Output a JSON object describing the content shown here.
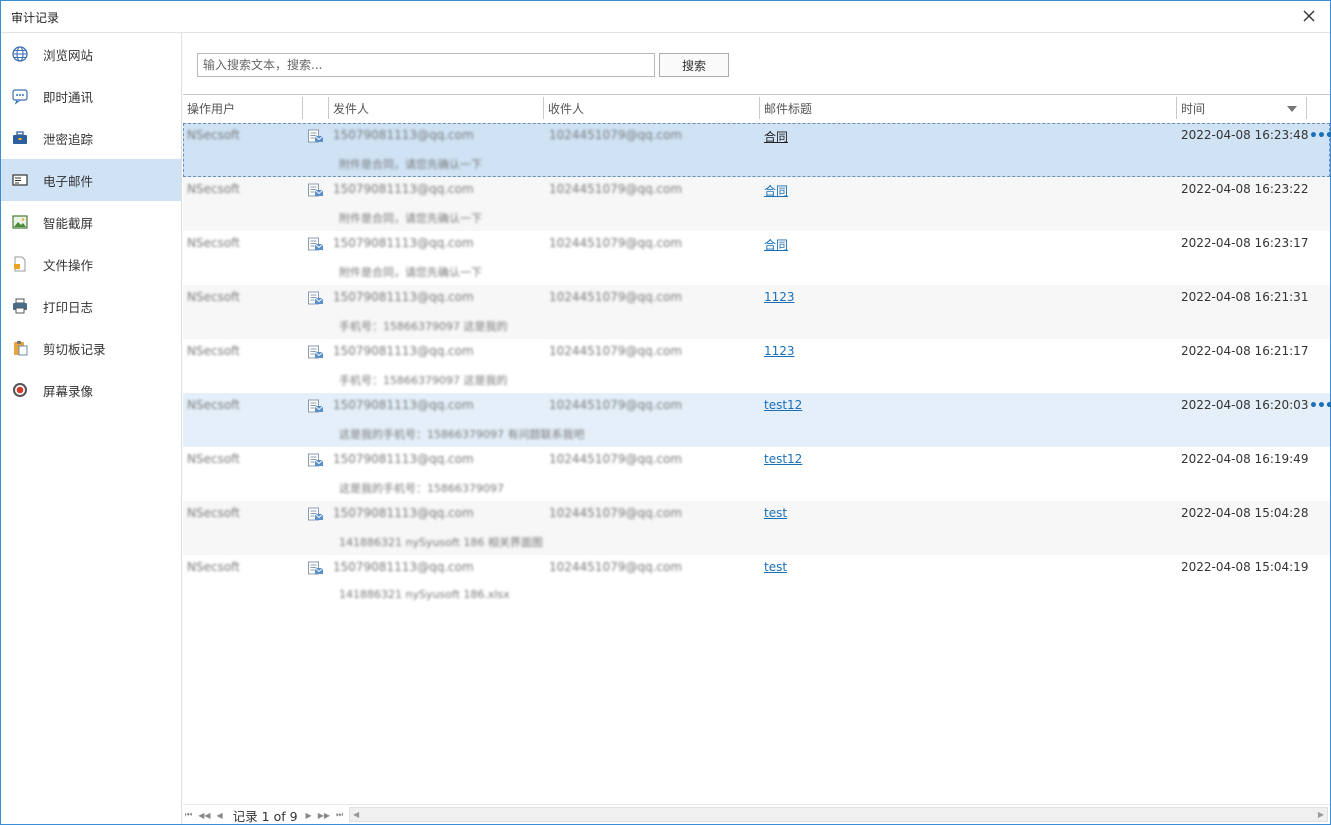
{
  "window": {
    "title": "审计记录"
  },
  "sidebar": {
    "items": [
      {
        "label": "浏览网站",
        "icon": "globe-icon"
      },
      {
        "label": "即时通讯",
        "icon": "chat-bubble-icon"
      },
      {
        "label": "泄密追踪",
        "icon": "briefcase-icon"
      },
      {
        "label": "电子邮件",
        "icon": "email-icon"
      },
      {
        "label": "智能截屏",
        "icon": "image-icon"
      },
      {
        "label": "文件操作",
        "icon": "file-icon"
      },
      {
        "label": "打印日志",
        "icon": "printer-icon"
      },
      {
        "label": "剪切板记录",
        "icon": "clipboard-icon"
      },
      {
        "label": "屏幕录像",
        "icon": "record-icon"
      }
    ],
    "active_index": 3
  },
  "search": {
    "placeholder": "输入搜索文本，搜索...",
    "button_label": "搜索"
  },
  "grid": {
    "columns": [
      "操作用户",
      "发件人",
      "收件人",
      "邮件标题",
      "时间"
    ],
    "rows": [
      {
        "user": "NSecsoft",
        "from": "15079081113@qq.com",
        "to": "1024451079@qq.com",
        "subject": "合同",
        "time": "2022-04-08 16:23:48",
        "snippet": "附件是合同，请您先确认一下"
      },
      {
        "user": "NSecsoft",
        "from": "15079081113@qq.com",
        "to": "1024451079@qq.com",
        "subject": "合同",
        "time": "2022-04-08 16:23:22",
        "snippet": "附件是合同，请您先确认一下"
      },
      {
        "user": "NSecsoft",
        "from": "15079081113@qq.com",
        "to": "1024451079@qq.com",
        "subject": "合同",
        "time": "2022-04-08 16:23:17",
        "snippet": "附件是合同，请您先确认一下"
      },
      {
        "user": "NSecsoft",
        "from": "15079081113@qq.com",
        "to": "1024451079@qq.com",
        "subject": "1123",
        "time": "2022-04-08 16:21:31",
        "snippet": "手机号：15866379097 这是我的"
      },
      {
        "user": "NSecsoft",
        "from": "15079081113@qq.com",
        "to": "1024451079@qq.com",
        "subject": "1123",
        "time": "2022-04-08 16:21:17",
        "snippet": "手机号：15866379097 这是我的"
      },
      {
        "user": "NSecsoft",
        "from": "15079081113@qq.com",
        "to": "1024451079@qq.com",
        "subject": "test12",
        "time": "2022-04-08 16:20:03",
        "snippet": "这是我的手机号：15866379097 有问题联系我吧"
      },
      {
        "user": "NSecsoft",
        "from": "15079081113@qq.com",
        "to": "1024451079@qq.com",
        "subject": "test12",
        "time": "2022-04-08 16:19:49",
        "snippet": "这是我的手机号：15866379097"
      },
      {
        "user": "NSecsoft",
        "from": "15079081113@qq.com",
        "to": "1024451079@qq.com",
        "subject": "test",
        "time": "2022-04-08 15:04:28",
        "snippet": "141886321 nySyusoft 186 相关界面图"
      },
      {
        "user": "NSecsoft",
        "from": "15079081113@qq.com",
        "to": "1024451079@qq.com",
        "subject": "test",
        "time": "2022-04-08 15:04:19",
        "snippet": "141886321 nySyusoft 186.xlsx"
      }
    ],
    "selected_index": 0,
    "hover_index": 5,
    "more_label": "•••"
  },
  "footer": {
    "record_text": "记录 1 of 9"
  },
  "colors": {
    "accent": "#3c8dd8",
    "selected_bg": "#cfe3f5",
    "link": "#1a6fb8"
  }
}
